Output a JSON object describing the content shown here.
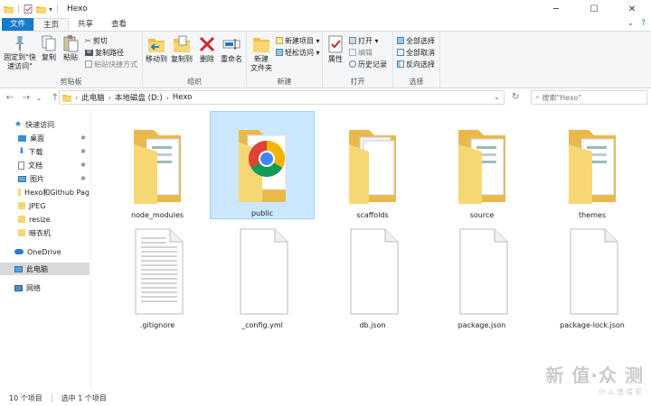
{
  "window": {
    "title": "Hexo",
    "buttons": [
      "─",
      "☐",
      "✕"
    ]
  },
  "tabs": {
    "file": "文件",
    "home": "主页",
    "share": "共享",
    "view": "查看",
    "expand": "⌄",
    "help": "?"
  },
  "ribbon": {
    "clipboard": {
      "label": "剪贴板",
      "pin": "固定到\"快\n速访问\"",
      "copy": "复制",
      "paste": "粘贴",
      "cut": "剪切",
      "copy_path": "复制路径",
      "paste_shortcut": "粘贴快捷方式"
    },
    "organize": {
      "label": "组织",
      "move_to": "移动到",
      "copy_to": "复制到",
      "delete": "删除",
      "rename": "重命名"
    },
    "new": {
      "label": "新建",
      "new_folder": "新建\n文件夹",
      "new_item": "新建项目 ▾",
      "easy_access": "轻松访问 ▾"
    },
    "open": {
      "label": "打开",
      "properties": "属性",
      "open": "打开 ▾",
      "edit": "编辑",
      "history": "历史记录"
    },
    "select": {
      "label": "选择",
      "select_all": "全部选择",
      "select_none": "全部取消",
      "invert": "反向选择"
    }
  },
  "address": {
    "back": "←",
    "forward": "→",
    "recent": "⌄",
    "up": "↑",
    "crumbs": [
      "此电脑",
      "本地磁盘 (D:)",
      "Hexo"
    ],
    "dropdown": "⌄",
    "refresh": "↻",
    "search_placeholder": "搜索\"Hexo\""
  },
  "nav": {
    "quick_access": "快速访问",
    "items": [
      {
        "label": "桌面",
        "pin": "✱"
      },
      {
        "label": "下载",
        "pin": "✱"
      },
      {
        "label": "文档",
        "pin": "✱"
      },
      {
        "label": "图片",
        "pin": "✱"
      },
      {
        "label": "Hexo和Github Pag"
      },
      {
        "label": "JPEG"
      },
      {
        "label": "resize"
      },
      {
        "label": "暗衣机"
      }
    ],
    "onedrive": "OneDrive",
    "this_pc": "此电脑",
    "network": "网络"
  },
  "files": [
    {
      "name": "node_modules",
      "type": "folder"
    },
    {
      "name": "public",
      "type": "folder-chrome"
    },
    {
      "name": "scaffolds",
      "type": "folder-paper"
    },
    {
      "name": "source",
      "type": "folder"
    },
    {
      "name": "themes",
      "type": "folder"
    },
    {
      "name": ".gitignore",
      "type": "text-file"
    },
    {
      "name": "_config.yml",
      "type": "file"
    },
    {
      "name": "db.json",
      "type": "file"
    },
    {
      "name": "package.json",
      "type": "file"
    },
    {
      "name": "package-lock.json",
      "type": "file"
    }
  ],
  "status": {
    "count": "10 个项目",
    "selected": "选中 1 个项目"
  },
  "watermark": {
    "main": "新 值·众 测",
    "sub": "什么值得买"
  },
  "colors": {
    "accent": "#1979ca",
    "selection": "#cce8ff",
    "folder": "#f7d774"
  }
}
